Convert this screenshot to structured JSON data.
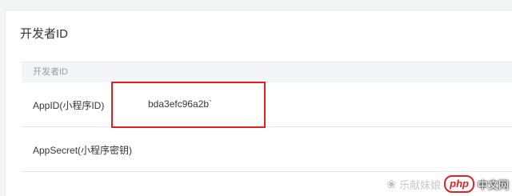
{
  "panel": {
    "title": "开发者ID",
    "table_header": "开发者ID",
    "rows": [
      {
        "label": "AppID(小程序ID)",
        "value": "bda3efc96a2b`"
      },
      {
        "label": "AppSecret(小程序密钥)",
        "value": ""
      }
    ]
  },
  "watermark": {
    "icon": "wechat-icon",
    "text": "乐献妹娘",
    "logo": "php",
    "site": "中文网"
  }
}
